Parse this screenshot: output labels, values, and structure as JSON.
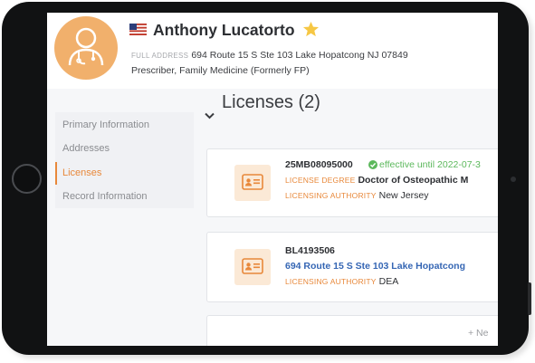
{
  "provider": {
    "name": "Anthony Lucatorto",
    "address_label": "FULL ADDRESS",
    "address": "694 Route 15 S Ste 103 Lake Hopatcong NJ 07849",
    "role": "Prescriber, Family Medicine (Formerly FP)",
    "favorite": true
  },
  "sidebar": {
    "items": [
      {
        "label": "Primary Information",
        "active": false
      },
      {
        "label": "Addresses",
        "active": false
      },
      {
        "label": "Licenses",
        "active": true
      },
      {
        "label": "Record Information",
        "active": false
      }
    ]
  },
  "licenses": {
    "heading": "Licenses (2)",
    "cards": [
      {
        "id": "25MB08095000",
        "effective": "effective until 2022-07-3",
        "degree_label": "LICENSE DEGREE",
        "degree": "Doctor of Osteopathic M",
        "authority_label": "LICENSING AUTHORITY",
        "authority": "New Jersey"
      },
      {
        "id": "BL4193506",
        "address_link": "694 Route 15 S Ste 103 Lake Hopatcong",
        "authority_label": "LICENSING AUTHORITY",
        "authority": "DEA"
      }
    ],
    "new_button": "+ Ne"
  },
  "colors": {
    "accent": "#e8883a",
    "avatar": "#f1b06c",
    "link": "#3566b4",
    "success": "#5cb85c"
  },
  "icons": {
    "avatar": "doctor-icon",
    "flag": "us-flag-icon",
    "favorite": "star-icon",
    "collapse": "chevron-down-icon",
    "license": "id-card-icon",
    "verified": "check-circle-icon"
  }
}
